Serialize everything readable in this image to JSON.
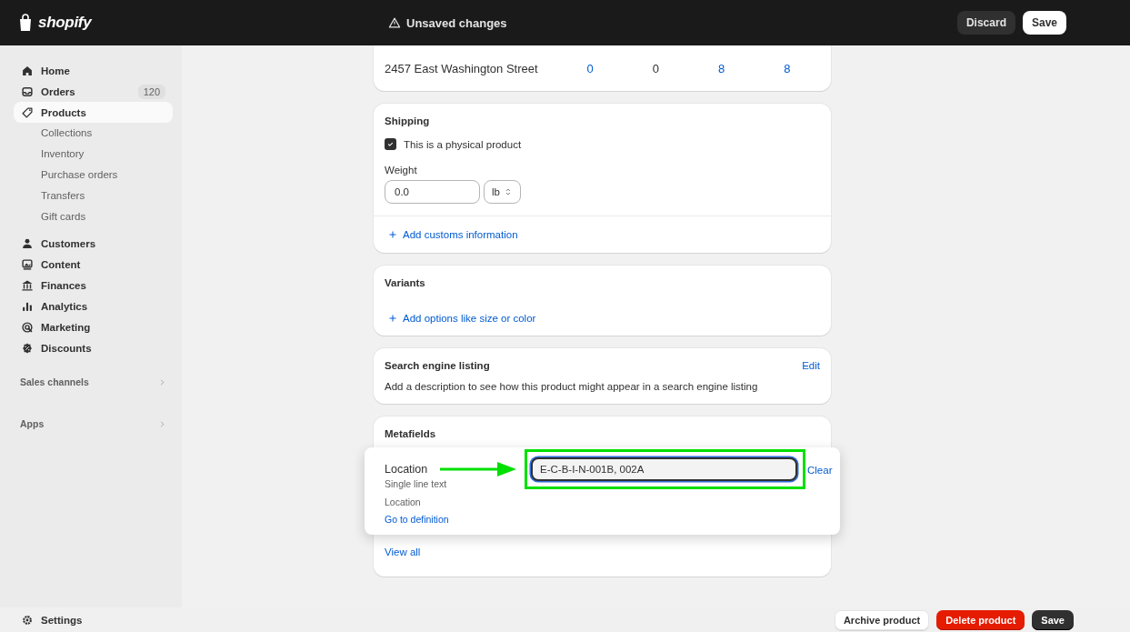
{
  "topbar": {
    "logo": "shopify",
    "status": "Unsaved changes",
    "buttons": [
      {
        "label": "Discard",
        "kind": "secondary"
      },
      {
        "label": "Save",
        "kind": "primary"
      }
    ]
  },
  "sidebar": {
    "items": [
      {
        "label": "Home",
        "selected": false
      },
      {
        "label": "Orders",
        "badge": "120",
        "selected": false
      },
      {
        "label": "Products",
        "selected": true,
        "children": [
          {
            "label": "Collections",
            "selected": false
          },
          {
            "label": "Inventory",
            "selected": false
          },
          {
            "label": "Purchase orders",
            "selected": false
          },
          {
            "label": "Transfers",
            "selected": false
          },
          {
            "label": "Gift cards",
            "selected": false
          }
        ]
      },
      {
        "label": "Customers",
        "selected": false
      },
      {
        "label": "Content",
        "selected": false
      },
      {
        "label": "Finances",
        "selected": false
      },
      {
        "label": "Analytics",
        "selected": false
      },
      {
        "label": "Marketing",
        "selected": false
      },
      {
        "label": "Discounts",
        "selected": false
      }
    ],
    "sections": [
      "Sales channels",
      "Apps"
    ],
    "settings": "Settings"
  },
  "inventory_row": {
    "location": "2457 East Washington Street",
    "cells": [
      {
        "text": "0",
        "kind": "link"
      },
      {
        "text": "0",
        "kind": "text"
      },
      {
        "text": "8",
        "kind": "link"
      },
      {
        "text": "8",
        "kind": "link"
      }
    ]
  },
  "shipping": {
    "title": "Shipping",
    "physical": {
      "label": "This is a physical product",
      "checked": true
    },
    "weight_label": "Weight",
    "weight_value": "0.0",
    "unit": "lb",
    "customs_link": "Add customs information"
  },
  "variants": {
    "title": "Variants",
    "link": "Add options like size or color"
  },
  "seo": {
    "title": "Search engine listing",
    "action": "Edit",
    "description": "Add a description to see how this product might appear in a search engine listing"
  },
  "metafields": {
    "title": "Metafields",
    "view_all": "View all",
    "popover": {
      "name": "Location",
      "type": "Single line text",
      "description": "Location",
      "definition_link": "Go to definition",
      "value": "E-C-B-I-N-001B, 002A",
      "focused": true,
      "clear": "Clear"
    }
  },
  "footer_buttons": [
    {
      "label": "Archive product",
      "kind": "secondary"
    },
    {
      "label": "Delete product",
      "kind": "critical"
    },
    {
      "label": "Save",
      "kind": "dark"
    }
  ]
}
